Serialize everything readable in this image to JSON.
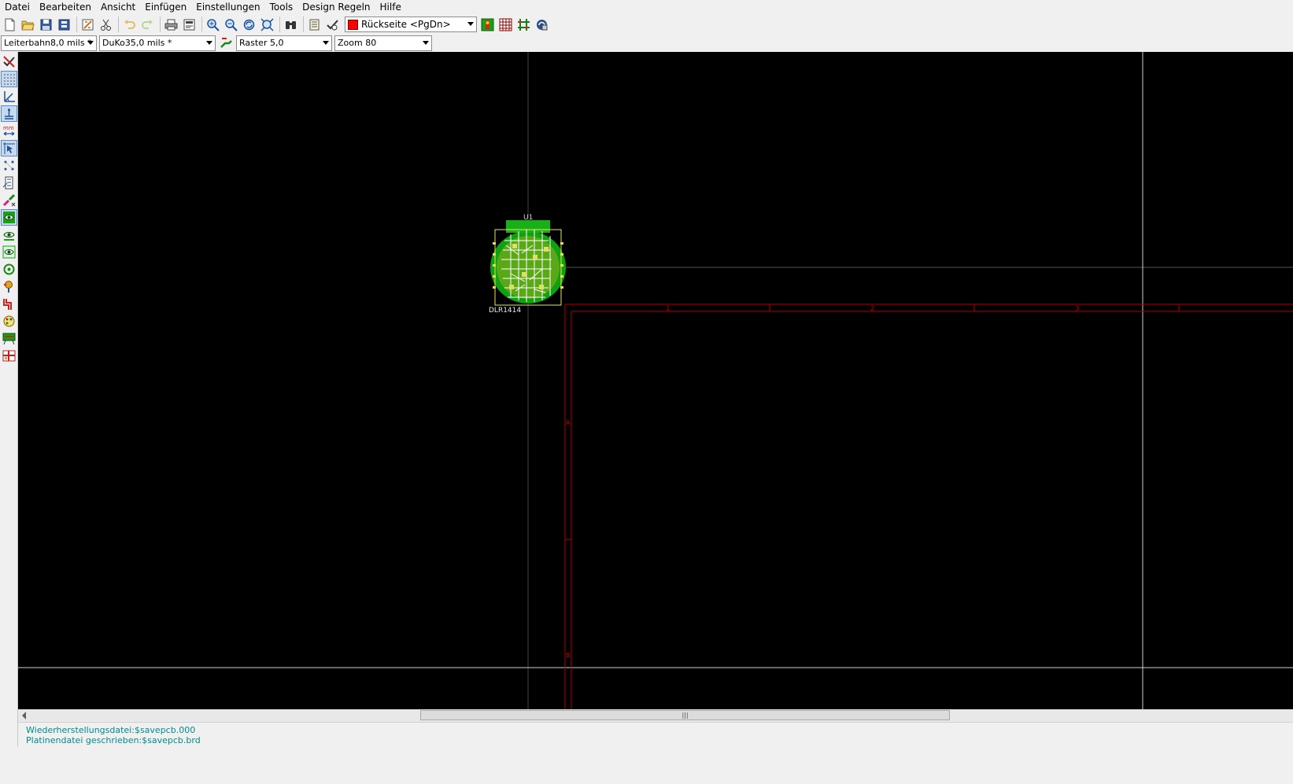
{
  "menu": {
    "items": [
      "Datei",
      "Bearbeiten",
      "Ansicht",
      "Einfügen",
      "Einstellungen",
      "Tools",
      "Design Regeln",
      "Hilfe"
    ]
  },
  "toolbar": {
    "layer_selector": {
      "label": "Rückseite <PgDn>",
      "color": "#ff0000"
    }
  },
  "toolbar2": {
    "track_width": "Leiterbahn8,0 mils *",
    "via_size": "DuKo35,0 mils *",
    "grid": "Raster 5,0",
    "zoom": "Zoom 80"
  },
  "canvas": {
    "background": "#000000",
    "component_reference": "U1",
    "component_value": "DLR1414",
    "frame_column_labels": [
      "1",
      "2",
      "3"
    ],
    "frame_row_labels": [
      "A",
      "B"
    ],
    "frame_color": "#b00000"
  },
  "status": {
    "line1": "Wiederherstellungsdatei:$savepcb.000",
    "line2": "Platinendatei geschrieben:$savepcb.brd"
  }
}
